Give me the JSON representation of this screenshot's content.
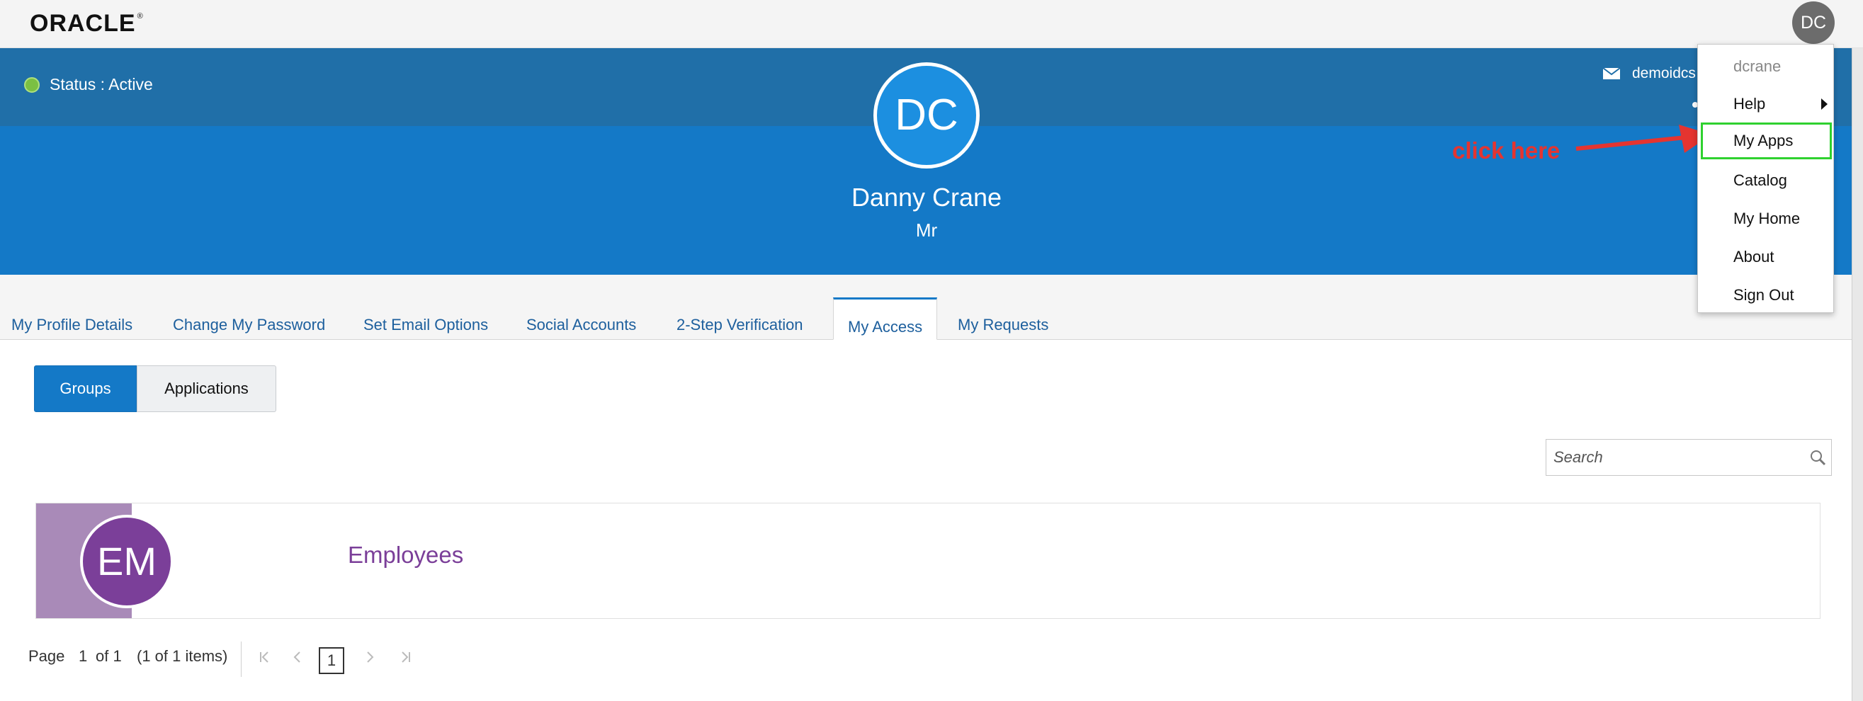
{
  "topbar": {
    "logo_text": "ORACLE",
    "logo_mark": "®",
    "avatar_initials": "DC"
  },
  "header": {
    "status_text": "Status : Active",
    "email_text": "demoidcs",
    "avatar_initials": "DC",
    "user_name": "Danny Crane",
    "user_title": "Mr",
    "colors": {
      "band": "#1479c7",
      "strip": "#206fa8",
      "status_dot": "#7bc043"
    }
  },
  "annotation": {
    "text": "click here",
    "color": "#e53430"
  },
  "tabs": [
    {
      "label": "My Profile Details",
      "active": false
    },
    {
      "label": "Change My Password",
      "active": false
    },
    {
      "label": "Set Email Options",
      "active": false
    },
    {
      "label": "Social Accounts",
      "active": false
    },
    {
      "label": "2-Step Verification",
      "active": false
    },
    {
      "label": "My Access",
      "active": true
    },
    {
      "label": "My Requests",
      "active": false
    }
  ],
  "toggle": {
    "groups_label": "Groups",
    "applications_label": "Applications",
    "selected": "Groups"
  },
  "search": {
    "placeholder": "Search"
  },
  "groups": [
    {
      "initials": "EM",
      "name": "Employees",
      "color": "#7b3f99"
    }
  ],
  "pagination": {
    "page_label": "Page",
    "page": "1",
    "of_label": "of 1",
    "items_label": "(1 of 1 items)",
    "current": "1"
  },
  "menu": {
    "username": "dcrane",
    "items": [
      {
        "label": "Help",
        "submenu": true
      },
      {
        "label": "My Apps",
        "highlighted": true
      },
      {
        "label": "Catalog"
      },
      {
        "label": "My Home"
      },
      {
        "label": "About"
      },
      {
        "label": "Sign Out"
      }
    ]
  },
  "icons": [
    "mail-icon",
    "search-icon",
    "first-page-icon",
    "prev-page-icon",
    "next-page-icon",
    "last-page-icon",
    "arrow-icon",
    "caret-right-icon"
  ]
}
